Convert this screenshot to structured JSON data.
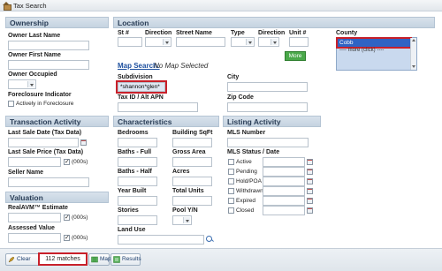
{
  "window": {
    "title": "Tax Search"
  },
  "ownership": {
    "header": "Ownership",
    "last_name_label": "Owner Last Name",
    "first_name_label": "Owner First Name",
    "occupied_label": "Owner Occupied",
    "foreclosure_label": "Foreclosure Indicator",
    "foreclosure_option": "Actively in Foreclosure"
  },
  "location": {
    "header": "Location",
    "street_no_label": "St #",
    "direction_label": "Direction",
    "street_name_label": "Street Name",
    "type_label": "Type",
    "direction2_label": "Direction",
    "unit_label": "Unit #",
    "county_label": "County",
    "county_selected": "Cobb",
    "county_more": "---- more (click) ----",
    "more_button": "More",
    "map_search_link": "Map Search:",
    "map_status": "No Map Selected",
    "subdivision_label": "Subdivision",
    "subdivision_value": "*shannon*glen*",
    "city_label": "City",
    "tax_id_label": "Tax ID / Alt APN",
    "zip_label": "Zip Code"
  },
  "transaction": {
    "header": "Transaction Activity",
    "last_sale_date_label": "Last Sale Date (Tax Data)",
    "last_sale_price_label": "Last Sale Price (Tax Data)",
    "price_unit": "(000s)",
    "seller_label": "Seller Name"
  },
  "valuation": {
    "header": "Valuation",
    "realavm_label": "RealAVM™ Estimate",
    "realavm_unit": "(000s)",
    "assessed_label": "Assessed Value",
    "assessed_unit": "(000s)"
  },
  "characteristics": {
    "header": "Characteristics",
    "bedrooms_label": "Bedrooms",
    "building_sqft_label": "Building SqFt",
    "baths_full_label": "Baths - Full",
    "gross_area_label": "Gross Area",
    "baths_half_label": "Baths - Half",
    "acres_label": "Acres",
    "year_built_label": "Year Built",
    "total_units_label": "Total Units",
    "stories_label": "Stories",
    "pool_label": "Pool Y/N",
    "land_use_label": "Land Use"
  },
  "listing": {
    "header": "Listing Activity",
    "mls_number_label": "MLS Number",
    "mls_status_label": "MLS Status / Date",
    "statuses": [
      "Active",
      "Pending",
      "Hold/POA",
      "Withdrawn",
      "Expired",
      "Closed"
    ]
  },
  "bottom": {
    "clear_label": "Clear",
    "matches_text": "112 matches",
    "map_label": "Map",
    "results_label": "Results"
  },
  "colors": {
    "accent": "#2f63c4",
    "highlight": "#c8202a",
    "green": "#4aa84a"
  }
}
